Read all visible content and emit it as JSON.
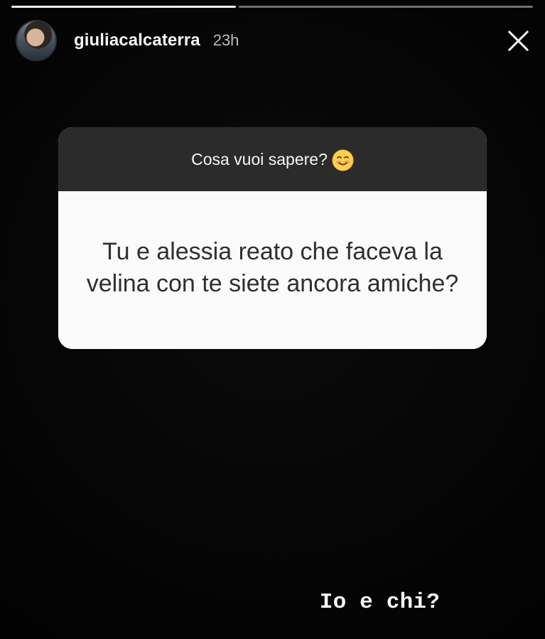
{
  "progress": {
    "completed_fraction": 0.43
  },
  "header": {
    "username": "giuliacalcaterra",
    "time": "23h",
    "avatar_icon": "profile-avatar",
    "close_icon": "close-icon"
  },
  "question_sticker": {
    "prompt": "Cosa vuoi sapere?",
    "emoji_icon": "smiling-face-emoji",
    "question": "Tu e alessia reato che faceva la velina con te siete ancora amiche?"
  },
  "reply": {
    "text": "Io e chi?"
  }
}
